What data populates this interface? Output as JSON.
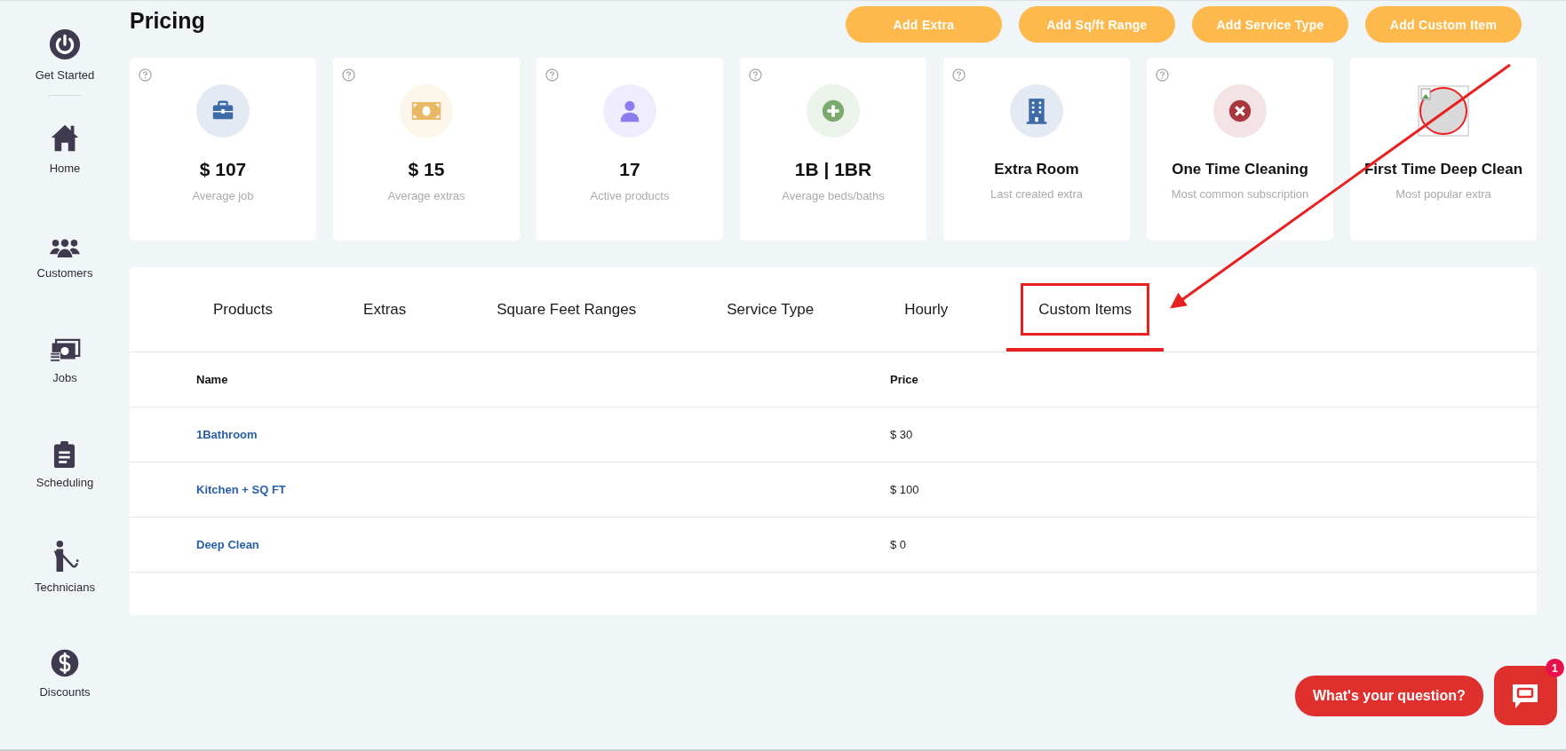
{
  "sidebar": {
    "items": [
      {
        "label": "Get Started"
      },
      {
        "label": "Home"
      },
      {
        "label": "Customers"
      },
      {
        "label": "Jobs"
      },
      {
        "label": "Scheduling"
      },
      {
        "label": "Technicians"
      },
      {
        "label": "Discounts"
      }
    ]
  },
  "page": {
    "title": "Pricing"
  },
  "actions": [
    "Add Extra",
    "Add Sq/ft Range",
    "Add Service Type",
    "Add Custom Item"
  ],
  "stats": [
    {
      "value": "$ 107",
      "caption": "Average job",
      "color": "#3e6aa8",
      "help": true
    },
    {
      "value": "$ 15",
      "caption": "Average extras",
      "color": "#e9b865",
      "help": true
    },
    {
      "value": "17",
      "caption": "Active products",
      "color": "#8b7cf0",
      "help": true
    },
    {
      "value": "1B | 1BR",
      "caption": "Average beds/baths",
      "color": "#7aab6d",
      "help": true
    },
    {
      "value": "Extra Room",
      "caption": "Last created extra",
      "color": "#3e6aa8",
      "help": true
    },
    {
      "value": "One Time Cleaning",
      "caption": "Most common subscription",
      "color": "#a8363e",
      "help": true
    },
    {
      "value": "First Time Deep Clean",
      "caption": "Most popular extra",
      "color": "#d9d9d9",
      "help": false
    }
  ],
  "tabs": [
    {
      "label": "Products",
      "selected": false
    },
    {
      "label": "Extras",
      "selected": false
    },
    {
      "label": "Square Feet Ranges",
      "selected": false
    },
    {
      "label": "Service Type",
      "selected": false
    },
    {
      "label": "Hourly",
      "selected": false
    },
    {
      "label": "Custom Items",
      "selected": true
    }
  ],
  "table": {
    "columns": [
      "Name",
      "Price"
    ],
    "rows": [
      {
        "name": "1Bathroom",
        "price": "$ 30"
      },
      {
        "name": "Kitchen + SQ FT",
        "price": "$ 100"
      },
      {
        "name": "Deep Clean",
        "price": "$ 0"
      }
    ]
  },
  "chat": {
    "prompt": "What's your question?",
    "badge": "1"
  }
}
